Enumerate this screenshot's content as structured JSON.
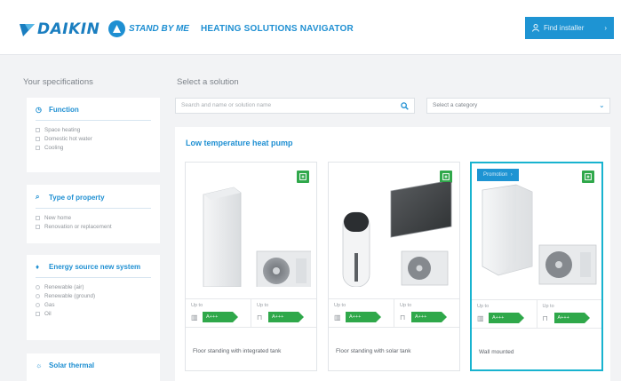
{
  "header": {
    "brand": "DAIKIN",
    "tagline": "STAND BY ME",
    "product": "HEATING SOLUTIONS NAVIGATOR",
    "find_installer": "Find installer",
    "colors": {
      "brand_blue": "#1a7ec0",
      "accent": "#1e94d3"
    }
  },
  "sidebar": {
    "title": "Your specifications",
    "filters": [
      {
        "icon": "clock-icon",
        "title": "Function",
        "type": "checkbox",
        "options": [
          "Space heating",
          "Domestic hot water",
          "Cooling"
        ]
      },
      {
        "icon": "house-search-icon",
        "title": "Type of property",
        "type": "checkbox",
        "options": [
          "New home",
          "Renovation or replacement"
        ]
      },
      {
        "icon": "energy-icon",
        "title": "Energy source new system",
        "type": "radio",
        "options": [
          "Renewable (air)",
          "Renewable (ground)",
          "Gas",
          "Oil"
        ]
      },
      {
        "icon": "solar-icon",
        "title": "Solar thermal",
        "type": "checkbox",
        "options": []
      }
    ]
  },
  "main": {
    "title": "Select a solution",
    "search_placeholder": "Search and name or solution name",
    "category_placeholder": "Select a category",
    "section_title": "Low temperature heat pump",
    "cards": [
      {
        "name": "Floor standing with integrated tank",
        "promo": "",
        "stats": [
          {
            "upto": "Up to",
            "rating": "A+++"
          },
          {
            "upto": "Up to",
            "rating": "A+++"
          }
        ]
      },
      {
        "name": "Floor standing with solar tank",
        "promo": "",
        "stats": [
          {
            "upto": "Up to",
            "rating": "A+++"
          },
          {
            "upto": "Up to",
            "rating": "A+++"
          }
        ]
      },
      {
        "name": "Wall mounted",
        "promo": "Promotion",
        "stats": [
          {
            "upto": "Up to",
            "rating": "A+++"
          },
          {
            "upto": "Up to",
            "rating": "A+++"
          }
        ]
      }
    ]
  }
}
